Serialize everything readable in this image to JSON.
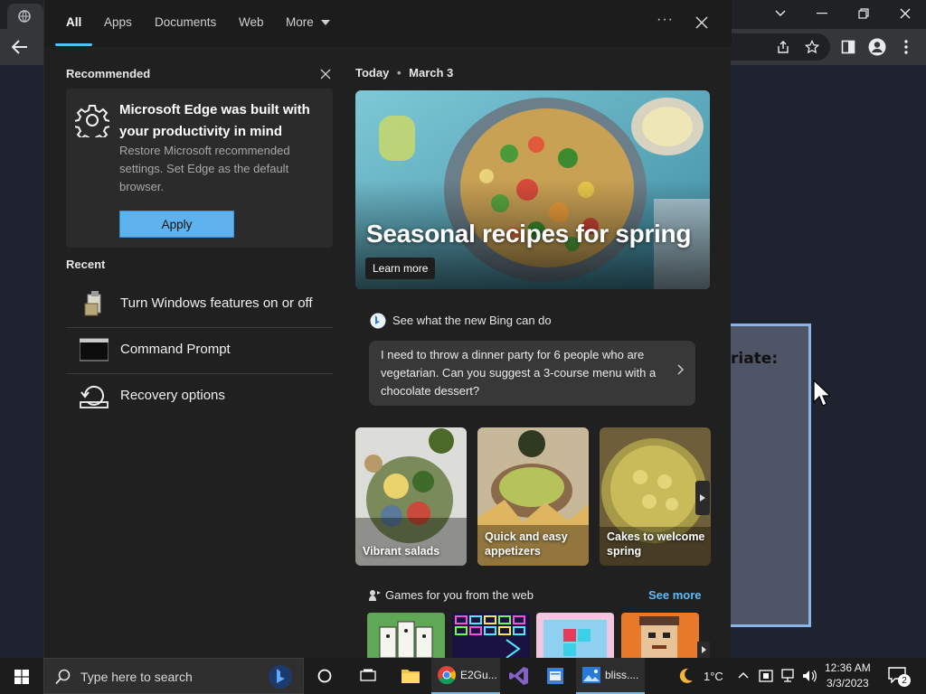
{
  "panel": {
    "tabs": [
      "All",
      "Apps",
      "Documents",
      "Web",
      "More"
    ],
    "more_options_label": "···",
    "recommended": {
      "heading": "Recommended",
      "title": "Microsoft Edge was built with your productivity in mind",
      "description": "Restore Microsoft recommended settings. Set Edge as the default browser.",
      "apply_label": "Apply"
    },
    "recent": {
      "heading": "Recent",
      "items": [
        {
          "label": "Turn Windows features on or off",
          "icon": "windows-features-icon"
        },
        {
          "label": "Command Prompt",
          "icon": "command-prompt-icon"
        },
        {
          "label": "Recovery options",
          "icon": "recovery-icon"
        }
      ]
    },
    "today": {
      "label": "Today",
      "date": "March 3",
      "hero_title": "Seasonal recipes for spring",
      "learn_more": "Learn more"
    },
    "bing": {
      "heading": "See what the new Bing can do",
      "prompt": "I need to throw a dinner party for 6 people who are vegetarian. Can you suggest a 3-course menu with a chocolate dessert?"
    },
    "food_cards": [
      {
        "label": "Vibrant salads"
      },
      {
        "label": "Quick and easy appetizers"
      },
      {
        "label": "Cakes to welcome spring"
      }
    ],
    "games": {
      "heading": "Games for you from the web",
      "see_more": "See more"
    }
  },
  "background": {
    "dialog_text": "riate:"
  },
  "taskbar": {
    "search_placeholder": "Type here to search",
    "apps": [
      {
        "label": "E2Gu...",
        "icon": "chrome-icon"
      },
      {
        "label": "bliss....",
        "icon": "photos-icon"
      }
    ],
    "weather": "1°C",
    "time": "12:36 AM",
    "date": "3/3/2023",
    "notification_count": "2"
  },
  "colors": {
    "accent": "#4cc2ff",
    "apply_button": "#5eb3ef",
    "see_more": "#5fbcf5",
    "panel_bg": "#202020"
  }
}
